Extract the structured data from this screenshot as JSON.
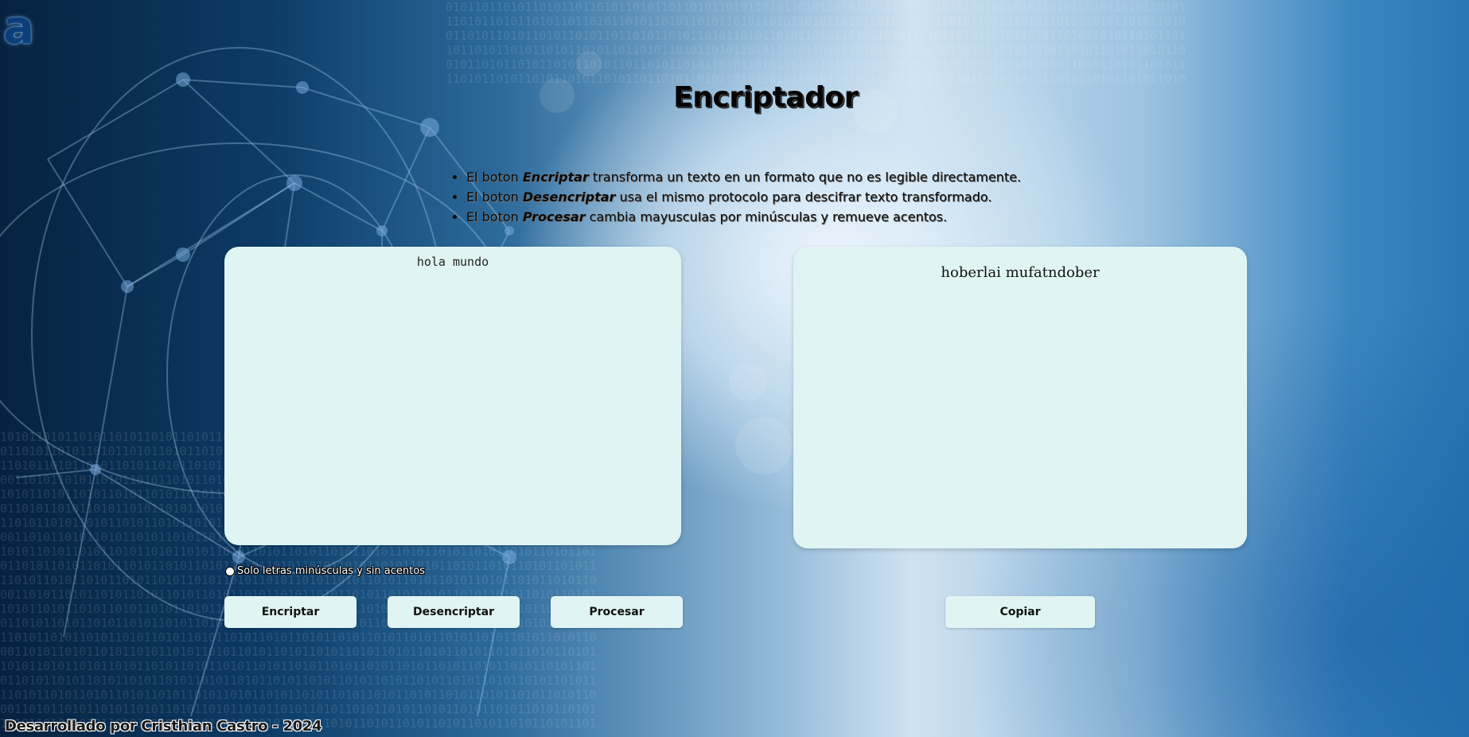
{
  "header": {
    "logo_glyph": "a",
    "title": "Encriptador"
  },
  "instructions": [
    {
      "prefix": "El boton ",
      "button": "Encriptar",
      "suffix": " transforma un texto en un formato que no es legible directamente."
    },
    {
      "prefix": "El boton ",
      "button": "Desencriptar",
      "suffix": " usa el mismo protocolo para descifrar texto transformado."
    },
    {
      "prefix": "El boton ",
      "button": "Procesar",
      "suffix": " cambia mayuscuIas por minúsculas y remueve acentos."
    }
  ],
  "input": {
    "value": "hola mundo"
  },
  "output": {
    "value": "hoberlai mufatndober"
  },
  "hint": {
    "icon": "info-circle-icon",
    "text": "Solo letras minúsculas y sin acentos"
  },
  "buttons": {
    "encrypt": "Encriptar",
    "decrypt": "Desencriptar",
    "process": "Procesar",
    "copy": "Copiar"
  },
  "footer": {
    "text": "Desarrollado por Cristhian Castro - 2024"
  }
}
